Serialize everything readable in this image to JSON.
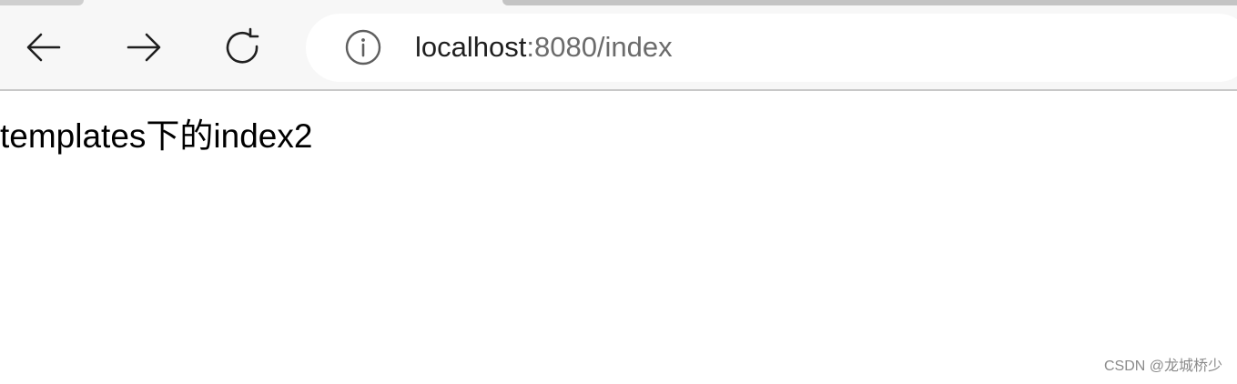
{
  "browser": {
    "back_icon": "arrow-left-icon",
    "forward_icon": "arrow-right-icon",
    "reload_icon": "reload-icon",
    "site_info_icon": "info-icon",
    "url_host": "localhost",
    "url_rest": ":8080/index"
  },
  "page": {
    "body_text": "templates下的index2"
  },
  "watermark": {
    "text": "CSDN @龙城桥少"
  }
}
